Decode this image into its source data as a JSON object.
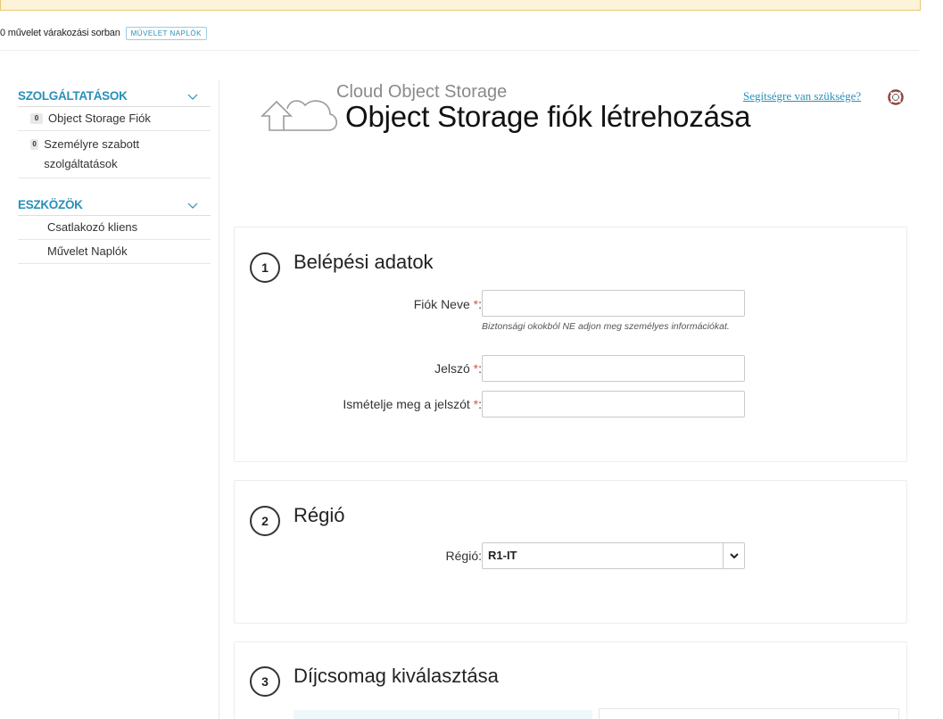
{
  "queue": {
    "text": "0 művelet várakozási sorban",
    "button_label": "MŰVELET NAPLÓK"
  },
  "sidebar": {
    "sections": [
      {
        "title": "SZOLGÁLTATÁSOK",
        "items": [
          {
            "badge": "0",
            "label": "Object Storage Fiók"
          },
          {
            "badge": "0",
            "label": "Személyre szabott szolgáltatások"
          }
        ]
      },
      {
        "title": "ESZKÖZÖK",
        "items": [
          {
            "label": "Csatlakozó kliens"
          },
          {
            "label": "Művelet Naplók"
          }
        ]
      }
    ]
  },
  "header": {
    "subtitle": "Cloud Object Storage",
    "title": "Object Storage fiók létrehozása",
    "help_link": "Segítségre van szüksége?"
  },
  "steps": [
    {
      "number": "1",
      "title": "Belépési adatok",
      "fields": [
        {
          "label": "Fiók Neve",
          "required": "*",
          "colon": ":",
          "value": "",
          "hint": "Biztonsági okokból NE adjon meg személyes információkat."
        },
        {
          "label": "Jelszó",
          "required": "*",
          "colon": ":",
          "value": ""
        },
        {
          "label": "Ismételje meg a jelszót",
          "required": "*",
          "colon": ":",
          "value": ""
        }
      ]
    },
    {
      "number": "2",
      "title": "Régió",
      "field": {
        "label": "Régió:",
        "selected": "R1-IT"
      }
    },
    {
      "number": "3",
      "title": "Díjcsomag kiválasztása"
    }
  ],
  "colors": {
    "accent": "#2a8fb8",
    "banner_bg": "#fcf3d8",
    "required": "#d9534f",
    "help_icon": "#c0392b"
  },
  "icons": {
    "cloud": "cloud-upload-icon",
    "help": "lifebuoy-icon",
    "chevron": "chevron-down-icon"
  }
}
